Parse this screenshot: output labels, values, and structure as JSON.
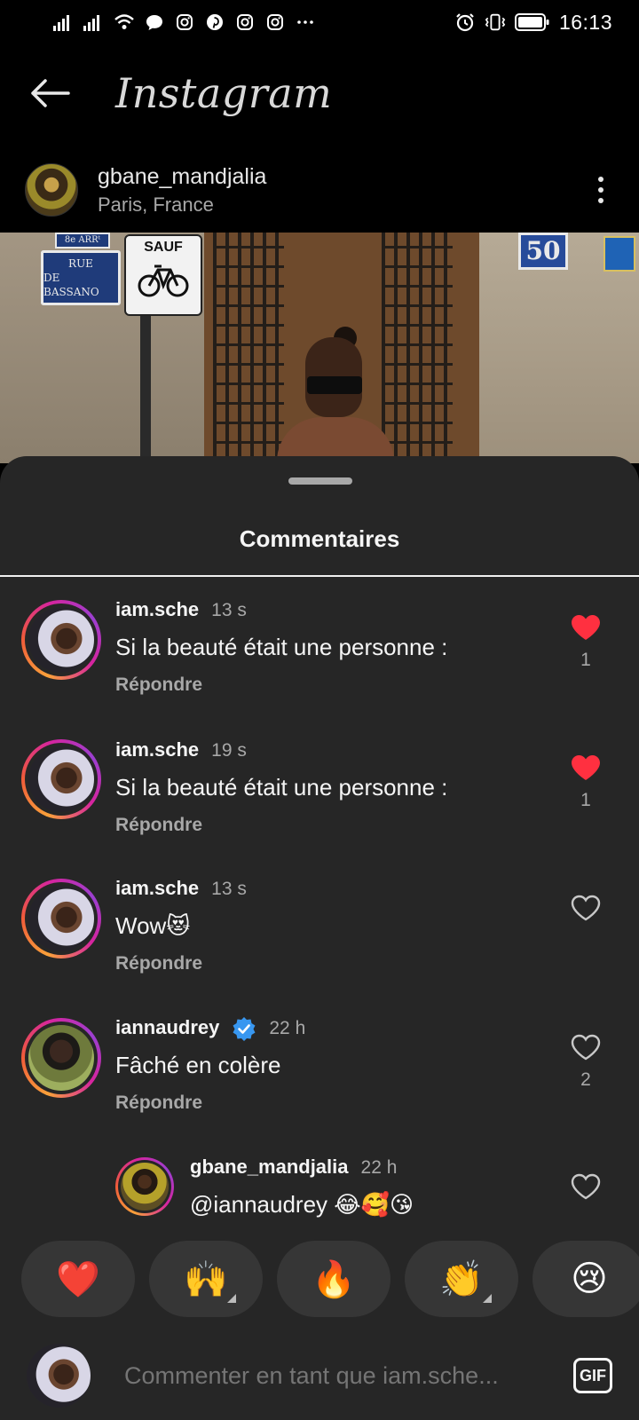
{
  "status_bar": {
    "time": "16:13",
    "left_icons": [
      "signal-icon",
      "signal-icon",
      "wifi-icon",
      "message-icon",
      "instagram-icon",
      "pinterest-icon",
      "instagram-icon",
      "instagram-icon",
      "more-notifications-icon"
    ],
    "right_icons": [
      "alarm-icon",
      "vibrate-icon",
      "battery-icon"
    ]
  },
  "header": {
    "brand": "Instagram"
  },
  "post": {
    "username": "gbane_mandjalia",
    "location": "Paris, France",
    "photo_signs": {
      "arrondissement": "8e ARRᵗ",
      "street_line1": "RUE",
      "street_line2": "DE BASSANO",
      "sauf": "SAUF",
      "number": "50"
    }
  },
  "sheet": {
    "title": "Commentaires"
  },
  "comments": [
    {
      "user": "iam.sche",
      "time": "13 s",
      "text": "Si la beauté était une personne :",
      "reply": "Répondre",
      "liked": true,
      "likes": "1"
    },
    {
      "user": "iam.sche",
      "time": "19 s",
      "text": "Si la beauté était une personne :",
      "reply": "Répondre",
      "liked": true,
      "likes": "1"
    },
    {
      "user": "iam.sche",
      "time": "13 s",
      "text": "Wow😻",
      "reply": "Répondre",
      "liked": false,
      "likes": ""
    },
    {
      "user": "iannaudrey",
      "time": "22 h",
      "text": "Fâché en colère",
      "reply": "Répondre",
      "liked": false,
      "likes": "2",
      "verified": true
    }
  ],
  "reply_comment": {
    "user": "gbane_mandjalia",
    "time": "22 h",
    "text": "@iannaudrey 😂🥰😘"
  },
  "reactions": [
    "❤️",
    "🙌",
    "🔥",
    "👏",
    "😢"
  ],
  "composer": {
    "placeholder": "Commenter en tant que iam.sche...",
    "gif_label": "GIF"
  },
  "colors": {
    "background": "#000000",
    "sheet": "#262626",
    "like_red": "#ff3040",
    "verified_blue": "#3897f0",
    "muted_text": "#a8a8a8"
  }
}
